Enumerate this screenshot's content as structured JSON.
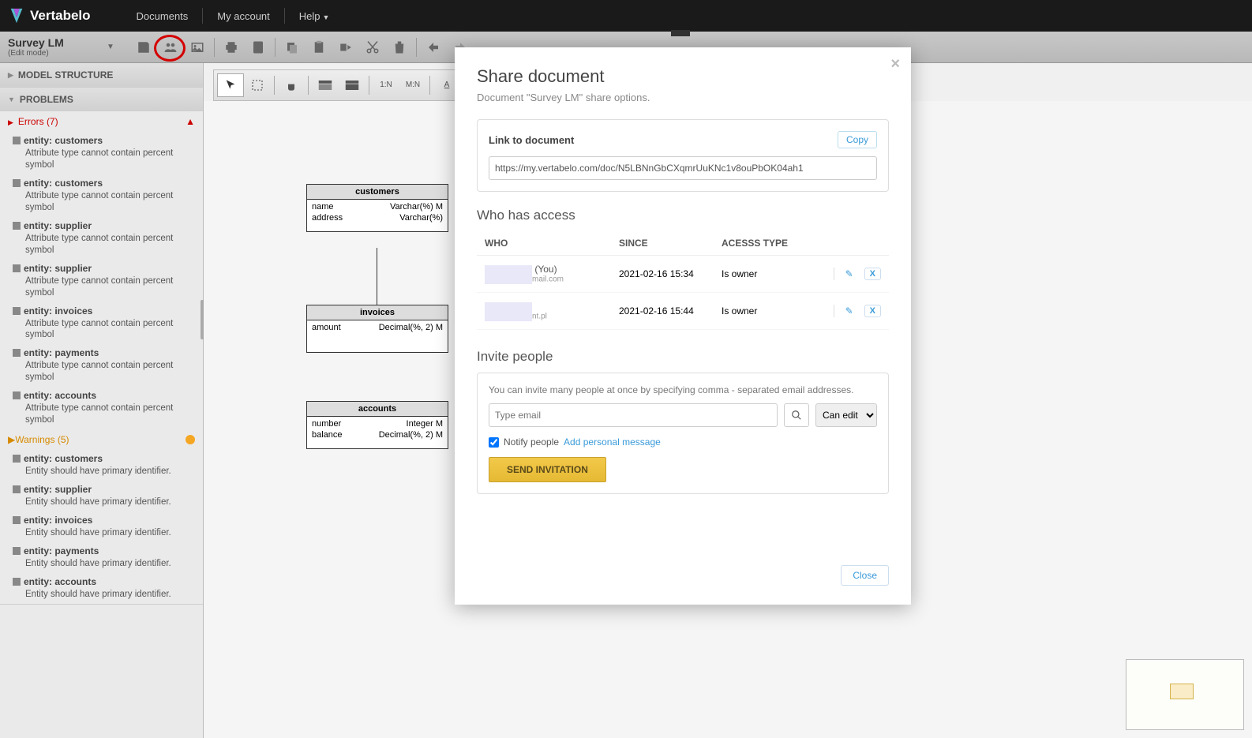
{
  "nav": {
    "brand": "Vertabelo",
    "documents": "Documents",
    "account": "My account",
    "help": "Help"
  },
  "doc": {
    "title": "Survey LM",
    "mode": "(Edit mode)"
  },
  "toolbar2": {
    "rel1n": "1:N",
    "relmn": "M:N",
    "a": "A"
  },
  "panel": {
    "model_structure": "MODEL STRUCTURE",
    "problems": "PROBLEMS",
    "errors_label": "Errors",
    "errors_count": "(7)",
    "warnings_label": "Warnings",
    "warnings_count": "(5)",
    "err_entity_prefix": "entity: ",
    "err_msg_percent": "Attribute type cannot contain percent symbol",
    "warn_msg_pk": "Entity should have primary identifier.",
    "errors": [
      {
        "entity": "customers"
      },
      {
        "entity": "customers"
      },
      {
        "entity": "supplier"
      },
      {
        "entity": "supplier"
      },
      {
        "entity": "invoices"
      },
      {
        "entity": "payments"
      },
      {
        "entity": "accounts"
      }
    ],
    "warnings": [
      {
        "entity": "customers"
      },
      {
        "entity": "supplier"
      },
      {
        "entity": "invoices"
      },
      {
        "entity": "payments"
      },
      {
        "entity": "accounts"
      }
    ]
  },
  "entities": {
    "customers": {
      "title": "customers",
      "rows": [
        {
          "name": "name",
          "type": "Varchar(%) M"
        },
        {
          "name": "address",
          "type": "Varchar(%)"
        }
      ]
    },
    "invoices": {
      "title": "invoices",
      "rows": [
        {
          "name": "amount",
          "type": "Decimal(%, 2) M"
        }
      ]
    },
    "accounts": {
      "title": "accounts",
      "rows": [
        {
          "name": "number",
          "type": "Integer        M"
        },
        {
          "name": "balance",
          "type": "Decimal(%, 2) M"
        }
      ]
    }
  },
  "modal": {
    "title": "Share document",
    "subtitle": "Document \"Survey LM\" share options.",
    "link_label": "Link to document",
    "copy": "Copy",
    "link_value": "https://my.vertabelo.com/doc/N5LBNnGbCXqmrUuKNc1v8ouPbOK04ah1",
    "who_has_access": "Who has access",
    "headers": {
      "who": "WHO",
      "since": "SINCE",
      "type": "ACESSS TYPE"
    },
    "rows": [
      {
        "name_suffix": " (You)",
        "email_suffix": "mail.com",
        "since": "2021-02-16 15:34",
        "type": "Is owner"
      },
      {
        "name_suffix": "",
        "email_suffix": "nt.pl",
        "since": "2021-02-16 15:44",
        "type": "Is owner"
      }
    ],
    "x": "X",
    "invite_title": "Invite people",
    "invite_note": "You can invite many people at once by specifying comma - separated email addresses.",
    "email_placeholder": "Type email",
    "perm": "Can edit",
    "notify": "Notify people",
    "personal_msg": "Add personal message",
    "send": "SEND INVITATION",
    "close": "Close"
  }
}
